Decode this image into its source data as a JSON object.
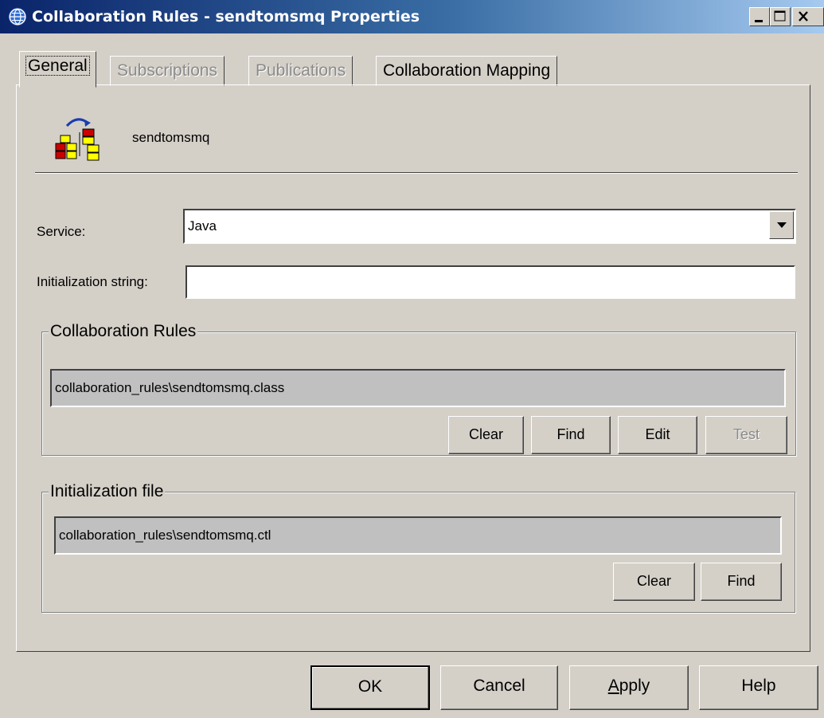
{
  "window": {
    "title": "Collaboration Rules - sendtomsmq Properties",
    "icon": "globe-icon",
    "controls": [
      "minimize-icon",
      "maximize-icon",
      "close-icon"
    ]
  },
  "tabs": [
    {
      "label": "General",
      "state": "active"
    },
    {
      "label": "Subscriptions",
      "state": "disabled"
    },
    {
      "label": "Publications",
      "state": "disabled"
    },
    {
      "label": "Collaboration Mapping",
      "state": "enabled"
    }
  ],
  "object": {
    "name": "sendtomsmq",
    "icon": "collaboration-rule-icon"
  },
  "service": {
    "label": "Service:",
    "value": "Java"
  },
  "init_string": {
    "label": "Initialization string:",
    "value": ""
  },
  "collab_rules": {
    "legend": "Collaboration Rules",
    "path": "collaboration_rules\\sendtomsmq.class",
    "buttons": {
      "clear": "Clear",
      "find": "Find",
      "edit": "Edit",
      "test": "Test"
    }
  },
  "init_file": {
    "legend": "Initialization file",
    "path": "collaboration_rules\\sendtomsmq.ctl",
    "buttons": {
      "clear": "Clear",
      "find": "Find"
    }
  },
  "footer": {
    "ok": "OK",
    "cancel": "Cancel",
    "apply_prefix": "A",
    "apply_rest": "pply",
    "help": "Help"
  },
  "colors": {
    "title_bar_start": "#0a246a",
    "title_bar_end": "#a6caf0",
    "face": "#d4d0c8",
    "readonly_field": "#c0c0c0"
  }
}
